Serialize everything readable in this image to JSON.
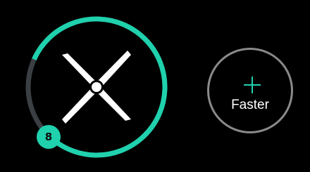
{
  "fan": {
    "speed_level": "8",
    "max_level": 10,
    "accent_color": "#1fd1ad",
    "track_color": "#3b3f44",
    "icon": "fan-blade-icon"
  },
  "controls": {
    "faster_label": "Faster",
    "faster_icon": "plus-icon",
    "ring_color": "#8a8a8a"
  }
}
